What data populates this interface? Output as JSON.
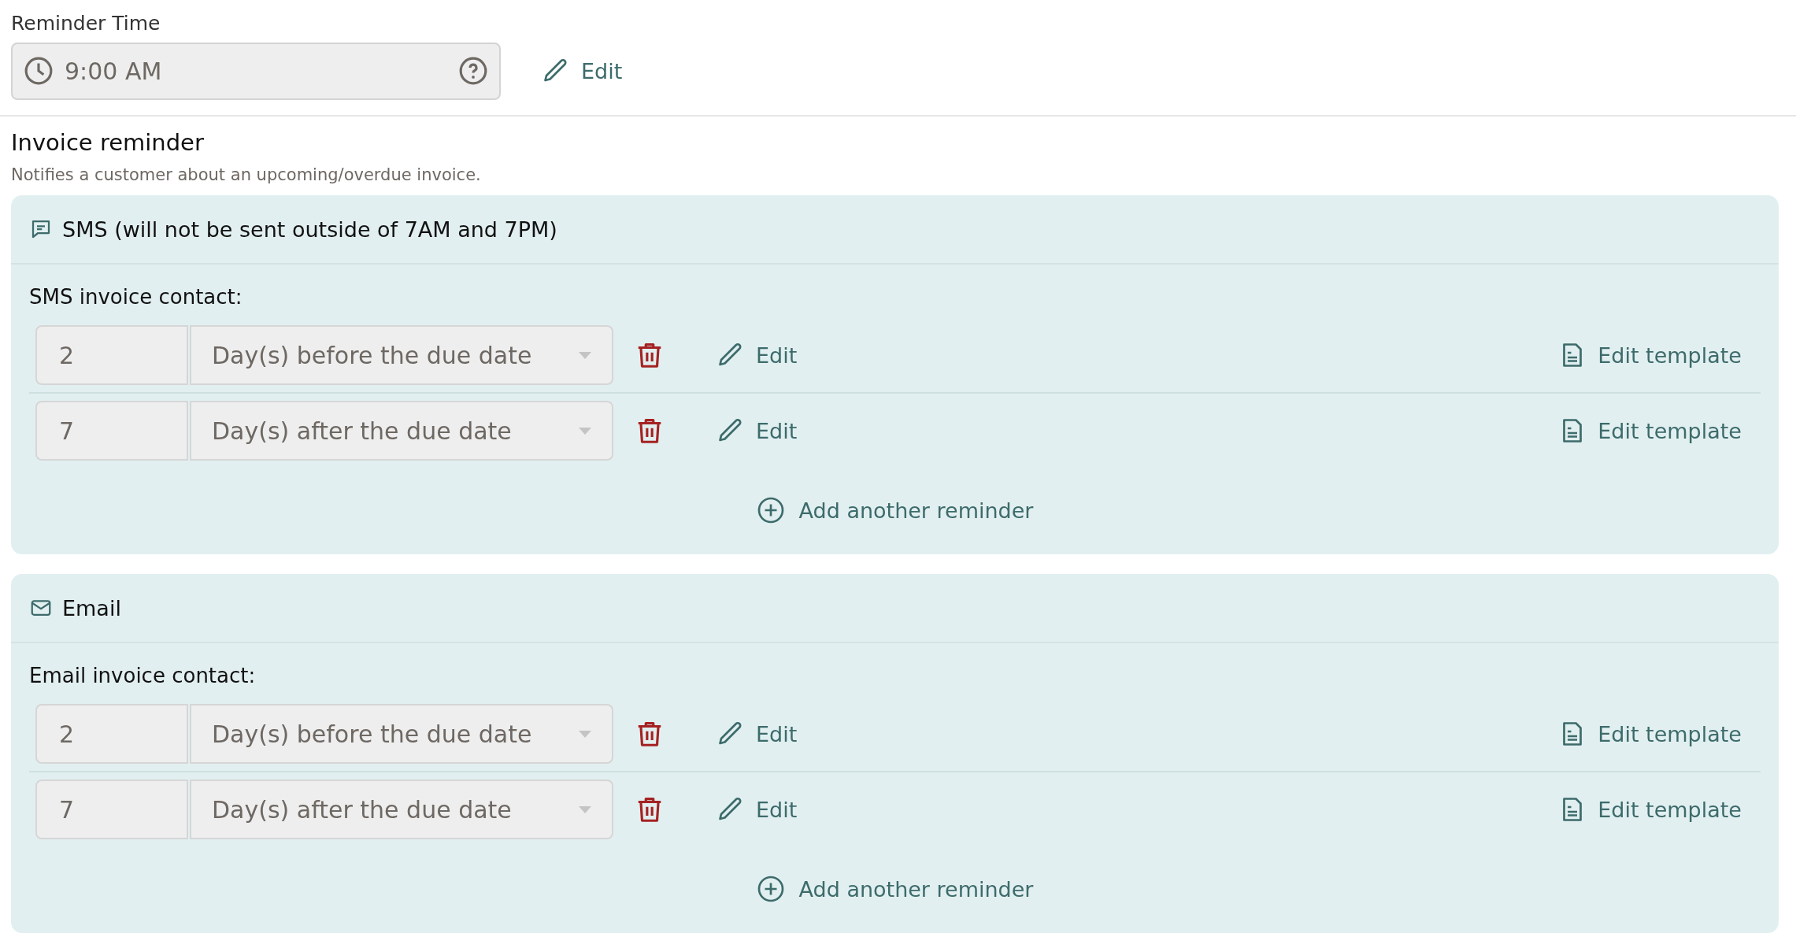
{
  "reminder_time": {
    "label": "Reminder Time",
    "value": "9:00 AM",
    "edit": "Edit"
  },
  "section": {
    "title": "Invoice reminder",
    "description": "Notifies a customer about an upcoming/overdue invoice."
  },
  "channels": [
    {
      "kind": "sms",
      "header": "SMS (will not be sent outside of 7AM and 7PM)",
      "contact_label": "SMS invoice contact:",
      "reminders": [
        {
          "days": "2",
          "timing": "Day(s) before the due date",
          "edit": "Edit",
          "template": "Edit template"
        },
        {
          "days": "7",
          "timing": "Day(s) after the due date",
          "edit": "Edit",
          "template": "Edit template"
        }
      ],
      "add": "Add another reminder"
    },
    {
      "kind": "email",
      "header": "Email",
      "contact_label": "Email invoice contact:",
      "reminders": [
        {
          "days": "2",
          "timing": "Day(s) before the due date",
          "edit": "Edit",
          "template": "Edit template"
        },
        {
          "days": "7",
          "timing": "Day(s) after the due date",
          "edit": "Edit",
          "template": "Edit template"
        }
      ],
      "add": "Add another reminder"
    }
  ]
}
